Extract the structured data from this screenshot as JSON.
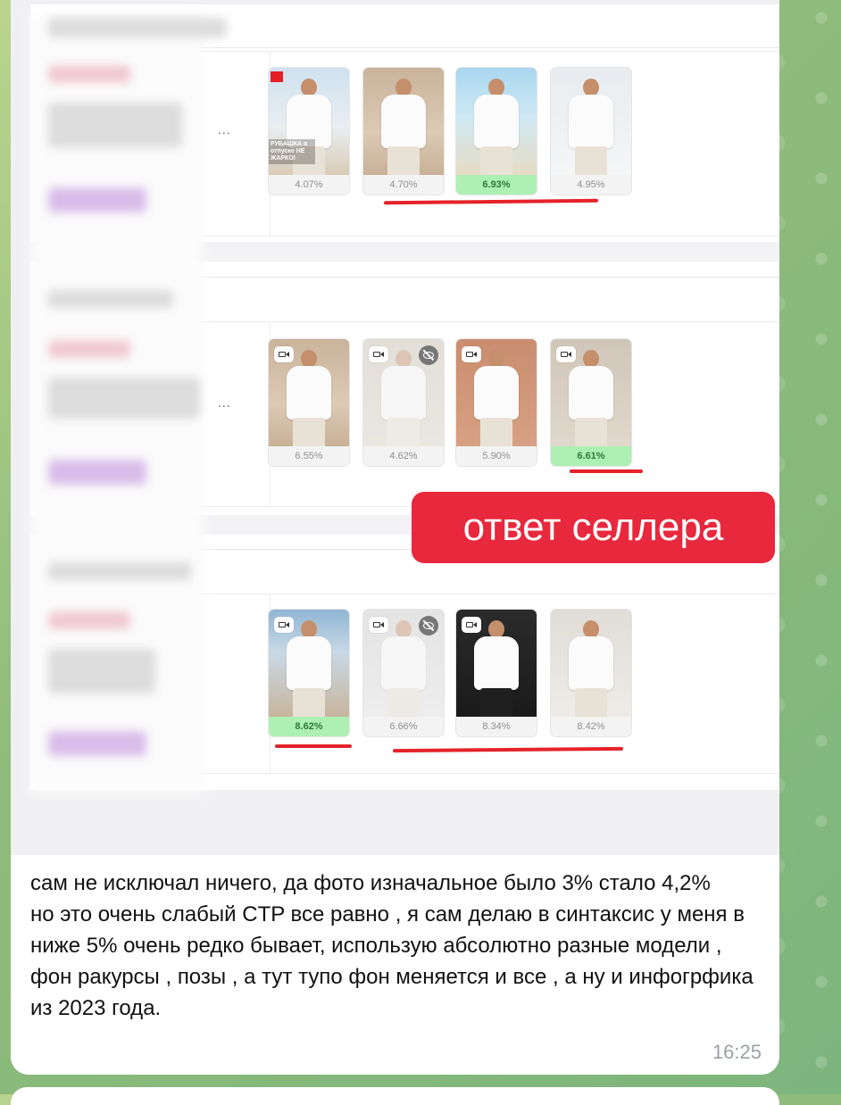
{
  "screenshot": {
    "rows": [
      {
        "cards": [
          {
            "ctr": "4.07%",
            "winner": false,
            "bg": "sky",
            "kind": "ad",
            "ad_text": "РУБАШКА в отпуске НЕ ЖАРКО!"
          },
          {
            "ctr": "4.70%",
            "winner": false,
            "bg": "warm",
            "kind": "photo"
          },
          {
            "ctr": "6.93%",
            "winner": true,
            "bg": "beach",
            "kind": "photo"
          },
          {
            "ctr": "4.95%",
            "winner": false,
            "bg": "pale",
            "kind": "photo"
          }
        ]
      },
      {
        "cards": [
          {
            "ctr": "6.55%",
            "winner": false,
            "bg": "warm",
            "kind": "video"
          },
          {
            "ctr": "4.62%",
            "winner": false,
            "bg": "stone",
            "kind": "video-hidden"
          },
          {
            "ctr": "5.90%",
            "winner": false,
            "bg": "terra",
            "kind": "video"
          },
          {
            "ctr": "6.61%",
            "winner": true,
            "bg": "stone",
            "kind": "video"
          }
        ]
      },
      {
        "cards": [
          {
            "ctr": "8.62%",
            "winner": true,
            "bg": "coast",
            "kind": "video"
          },
          {
            "ctr": "6.66%",
            "winner": false,
            "bg": "grey",
            "kind": "video-hidden"
          },
          {
            "ctr": "8.34%",
            "winner": false,
            "bg": "dark",
            "kind": "video"
          },
          {
            "ctr": "8.42%",
            "winner": false,
            "bg": "villa",
            "kind": "photo"
          }
        ]
      }
    ],
    "seller_label": "ответ селлера",
    "ellipsis": "..."
  },
  "message": {
    "lines": [
      "сам не исключал ничего, да фото изначальное было 3% стало 4,2%",
      "но это очень слабый CTP все равно , я сам делаю в синтаксис у меня в ниже 5%  очень редко бывает, использую абсолютно разные модели , фон ракурсы , позы , а тут тупо фон меняется и все , а ну и инфогрфика из 2023 года."
    ],
    "time": "16:25"
  },
  "colors": {
    "accent_red": "#e8283d",
    "underline_red": "#e52229",
    "winner_green": "#aef0b4"
  }
}
